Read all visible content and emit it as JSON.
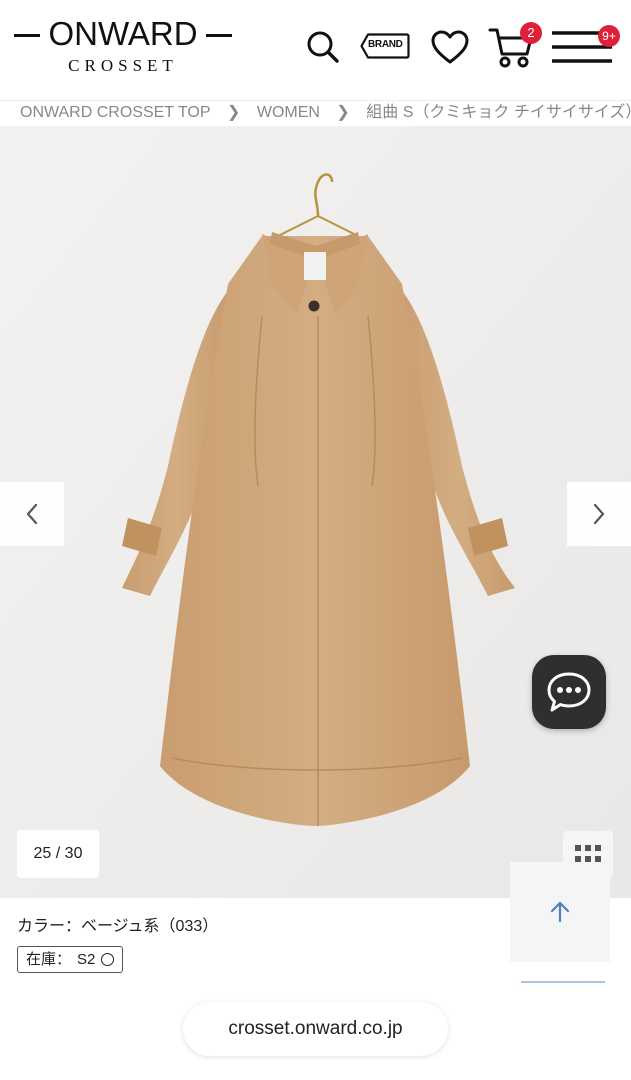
{
  "header": {
    "logo_main": "ONWARD",
    "logo_sub": "CROSSET",
    "brand_label": "BRAND",
    "cart_count": "2",
    "menu_badge": "9+"
  },
  "breadcrumb": {
    "items": [
      "ONWARD CROSSET TOP",
      "WOMEN",
      "組曲 S（クミキョク チイサイサイズ）"
    ]
  },
  "gallery": {
    "counter": "25 / 30",
    "product_color": "#d0a97f"
  },
  "product": {
    "color_text": "カラー：ベージュ系（033）",
    "stock_label": "在庫：",
    "stock_size": "S2"
  },
  "footer": {
    "url": "crosset.onward.co.jp"
  },
  "colors": {
    "badge": "#e0203a",
    "chat_bg": "#2f2f2f",
    "scroll_top_arrow": "#4a7fc0"
  },
  "icons": [
    "search-icon",
    "brand-tag-icon",
    "heart-icon",
    "cart-icon",
    "menu-icon",
    "chevron-left-icon",
    "chevron-right-icon",
    "grid-icon",
    "chat-icon",
    "arrow-up-icon"
  ]
}
